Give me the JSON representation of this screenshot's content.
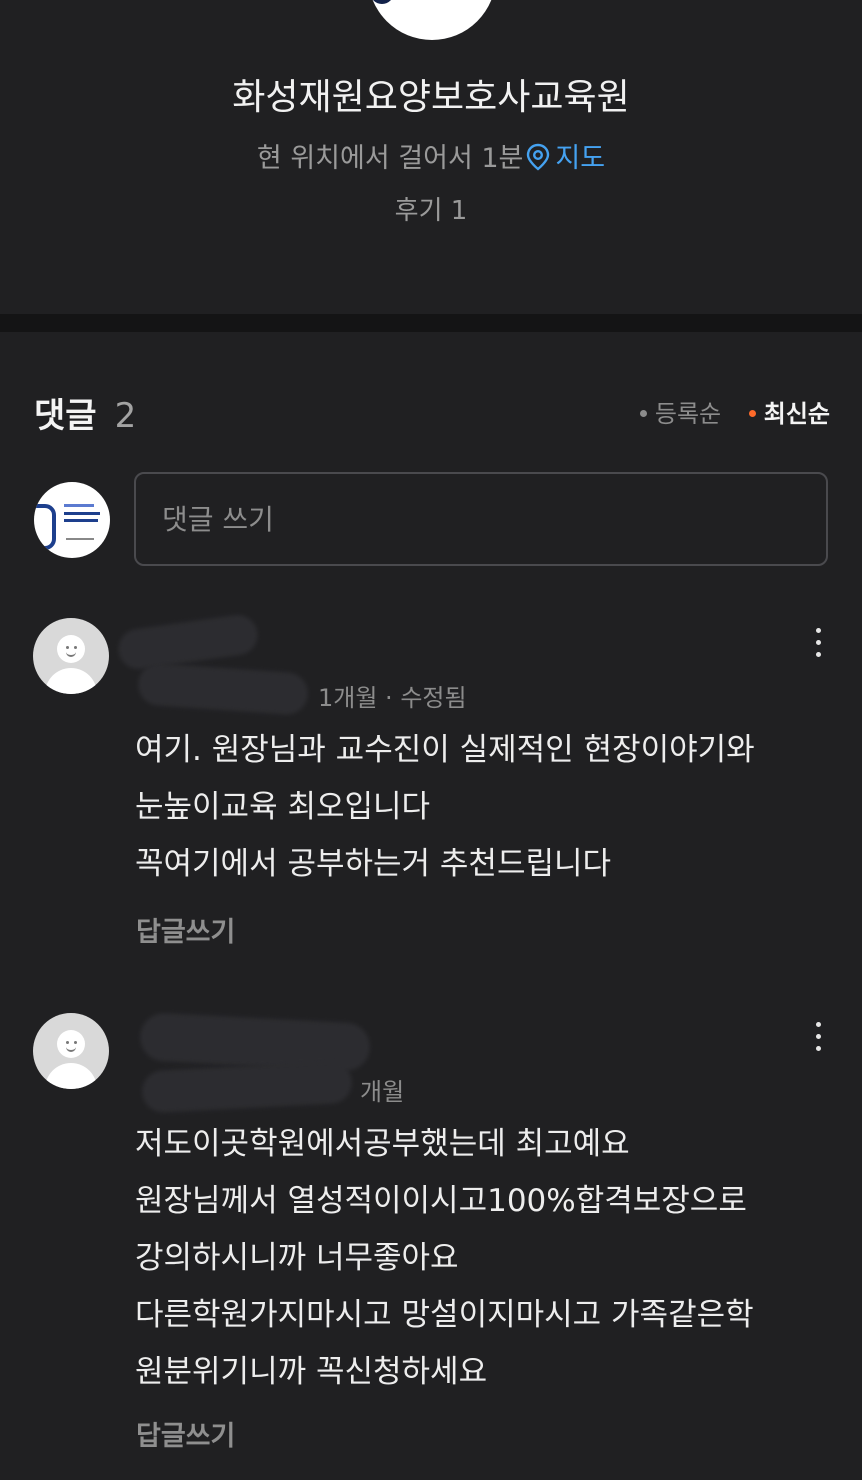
{
  "place": {
    "name": "화성재원요양보호사교육원",
    "distance": "현 위치에서 걸어서 1분",
    "map_link": "지도",
    "reviews": "후기 1"
  },
  "comments_section": {
    "title": "댓글",
    "count": "2",
    "sort_options": [
      {
        "label": "등록순",
        "active": false
      },
      {
        "label": "최신순",
        "active": true
      }
    ],
    "input_placeholder": "댓글 쓰기"
  },
  "comments": [
    {
      "author": "",
      "meta": "1개월 · 수정됨",
      "body": "여기. 원장님과 교수진이 실제적인 현장이야기와\n눈높이교육 최오입니다\n꼭여기에서 공부하는거 추천드립니다",
      "reply_label": "답글쓰기"
    },
    {
      "author": "",
      "meta": "개월",
      "body": "저도이곳학원에서공부했는데 최고예요\n원장님께서 열성적이이시고100%합격보장으로\n강의하시니까 너무좋아요\n다른학원가지마시고 망설이지마시고 가족같은학\n원분위기니까 꼭신청하세요",
      "reply_label": "답글쓰기"
    }
  ],
  "colors": {
    "background": "#202022",
    "accent_link": "#45a2f1",
    "active_sort_dot": "#ff6a2a"
  },
  "icons": [
    "location-pin-icon",
    "more-vertical-icon",
    "default-avatar-icon"
  ]
}
